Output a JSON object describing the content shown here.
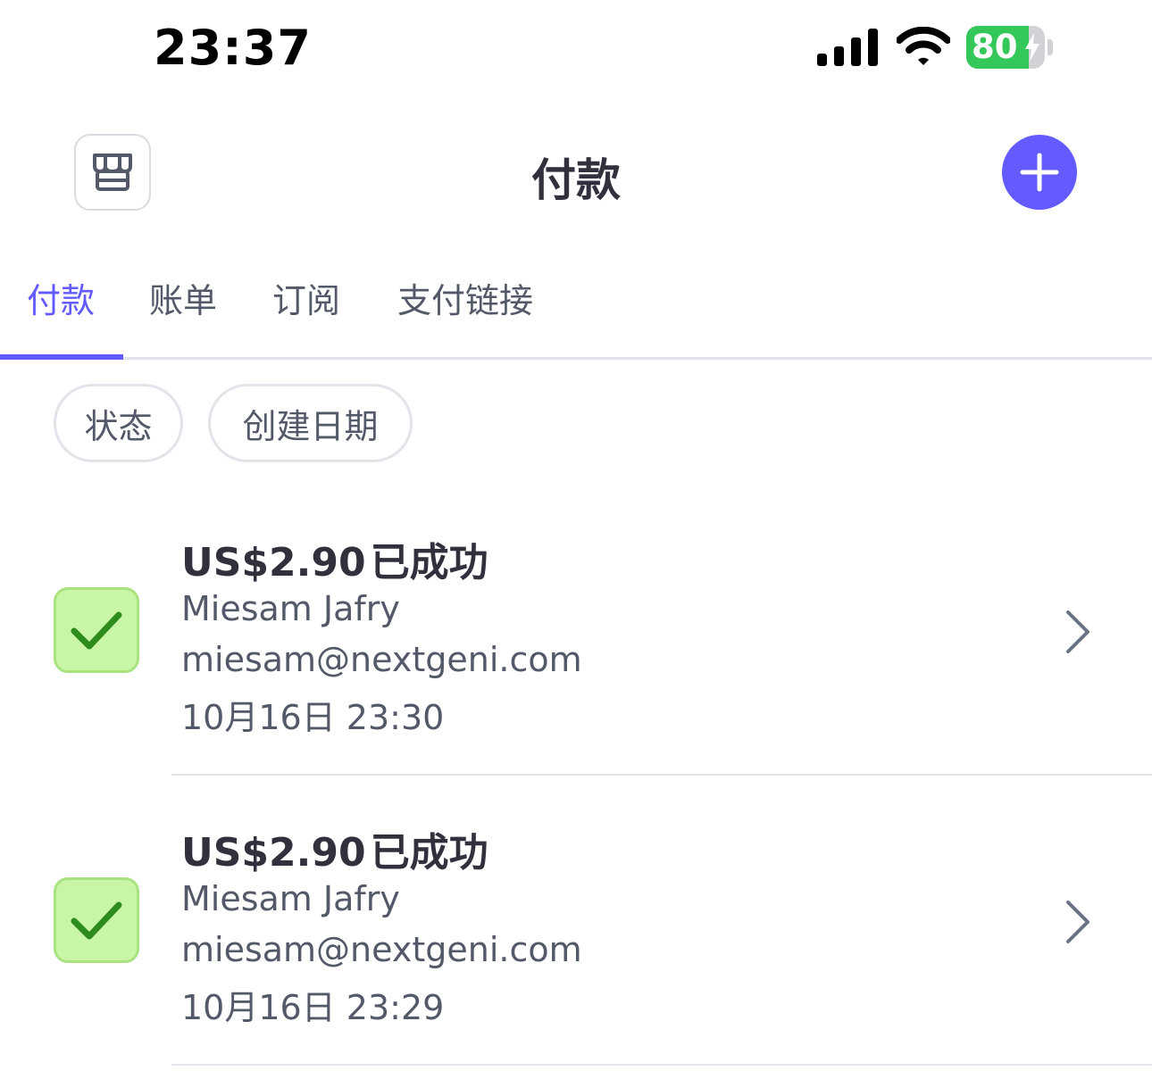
{
  "status_bar": {
    "time": "23:37",
    "battery_level": "80",
    "battery_fraction": 0.8,
    "icons": [
      "signal-icon",
      "wifi-icon",
      "battery-charging-icon"
    ]
  },
  "header": {
    "title": "付款",
    "left_icon": "store-icon",
    "right_icon": "plus-icon",
    "accent_color": "#635bff"
  },
  "tabs": [
    {
      "label": "付款",
      "active": true
    },
    {
      "label": "账单",
      "active": false
    },
    {
      "label": "订阅",
      "active": false
    },
    {
      "label": "支付链接",
      "active": false
    }
  ],
  "filters": [
    {
      "label": "状态"
    },
    {
      "label": "创建日期"
    }
  ],
  "payments": [
    {
      "amount": "US$2.90",
      "status": "已成功",
      "customer_name": "Miesam Jafry",
      "customer_email": "miesam@nextgeni.com",
      "date": "10月16日 23:30",
      "status_icon": "check-icon"
    },
    {
      "amount": "US$2.90",
      "status": "已成功",
      "customer_name": "Miesam Jafry",
      "customer_email": "miesam@nextgeni.com",
      "date": "10月16日 23:29",
      "status_icon": "check-icon"
    }
  ],
  "colors": {
    "success_bg": "#c8f5a6",
    "success_check": "#2e8b1e",
    "battery_green": "#34c759"
  }
}
